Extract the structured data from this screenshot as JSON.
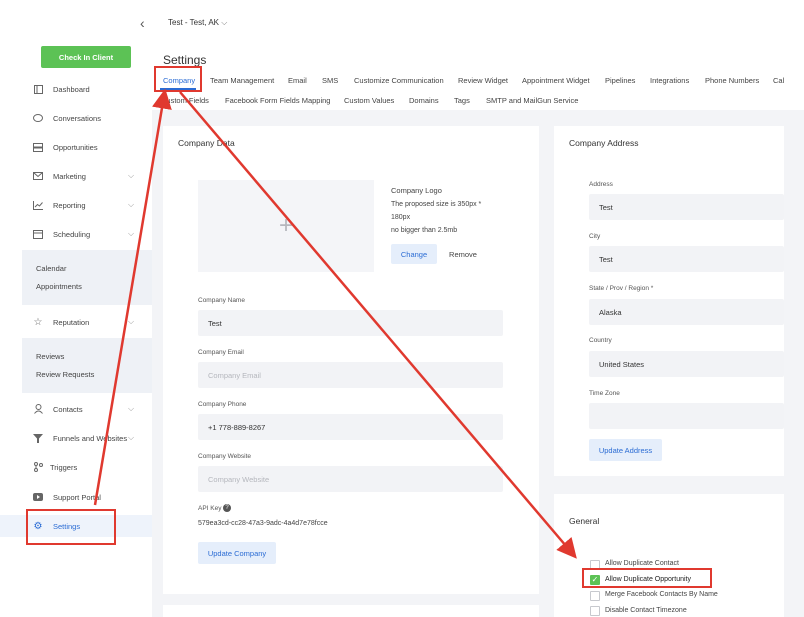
{
  "location": "Test - Test, AK",
  "sidebar": {
    "check_in": "Check In Client",
    "items": [
      {
        "label": "Dashboard",
        "icon": "dashboard-icon"
      },
      {
        "label": "Conversations",
        "icon": "chat-icon"
      },
      {
        "label": "Opportunities",
        "icon": "layers-icon"
      },
      {
        "label": "Marketing",
        "icon": "mail-icon"
      },
      {
        "label": "Reporting",
        "icon": "chart-icon"
      },
      {
        "label": "Scheduling",
        "icon": "calendar-icon"
      },
      {
        "label": "Reputation",
        "icon": "star-icon"
      },
      {
        "label": "Contacts",
        "icon": "user-icon"
      },
      {
        "label": "Funnels and Websites",
        "icon": "funnel-icon"
      },
      {
        "label": "Triggers",
        "icon": "branch-icon"
      },
      {
        "label": "Support Portal",
        "icon": "video-icon"
      },
      {
        "label": "Settings",
        "icon": "gear-icon"
      }
    ],
    "scheduling_sub": [
      "Calendar",
      "Appointments"
    ],
    "reputation_sub": [
      "Reviews",
      "Review Requests"
    ]
  },
  "settings_title": "Settings",
  "tabs_row1": [
    "Company",
    "Team Management",
    "Email",
    "SMS",
    "Customize Communication",
    "Review Widget",
    "Appointment Widget",
    "Pipelines",
    "Integrations",
    "Phone Numbers",
    "Cal"
  ],
  "tabs_row2": [
    "Custom Fields",
    "Facebook Form Fields Mapping",
    "Custom Values",
    "Domains",
    "Tags",
    "SMTP and MailGun Service"
  ],
  "company": {
    "title": "Company Data",
    "logo_label": "Company Logo",
    "logo_hint1": "The proposed size is 350px *",
    "logo_hint2": "180px",
    "logo_hint3": "no bigger than 2.5mb",
    "change": "Change",
    "remove": "Remove",
    "name_label": "Company Name",
    "name_value": "Test",
    "email_label": "Company Email",
    "email_placeholder": "Company Email",
    "phone_label": "Company Phone",
    "phone_value": "+1 778-889-8267",
    "website_label": "Company Website",
    "website_placeholder": "Company Website",
    "api_label": "API Key",
    "api_value": "579ea3cd-cc28-47a3-9adc-4a4d7e78fcce",
    "update": "Update Company"
  },
  "address": {
    "title": "Company Address",
    "address_label": "Address",
    "address_value": "Test",
    "city_label": "City",
    "city_value": "Test",
    "state_label": "State / Prov / Region *",
    "state_value": "Alaska",
    "country_label": "Country",
    "country_value": "United States",
    "tz_label": "Time Zone",
    "update": "Update Address"
  },
  "general": {
    "title": "General",
    "options": [
      {
        "label": "Allow Duplicate Contact",
        "checked": false
      },
      {
        "label": "Allow Duplicate Opportunity",
        "checked": true
      },
      {
        "label": "Merge Facebook Contacts By Name",
        "checked": false
      },
      {
        "label": "Disable Contact Timezone",
        "checked": false
      }
    ]
  },
  "colors": {
    "accent": "#2b6cd4",
    "green": "#5cc255",
    "annotation": "#e0392f"
  }
}
